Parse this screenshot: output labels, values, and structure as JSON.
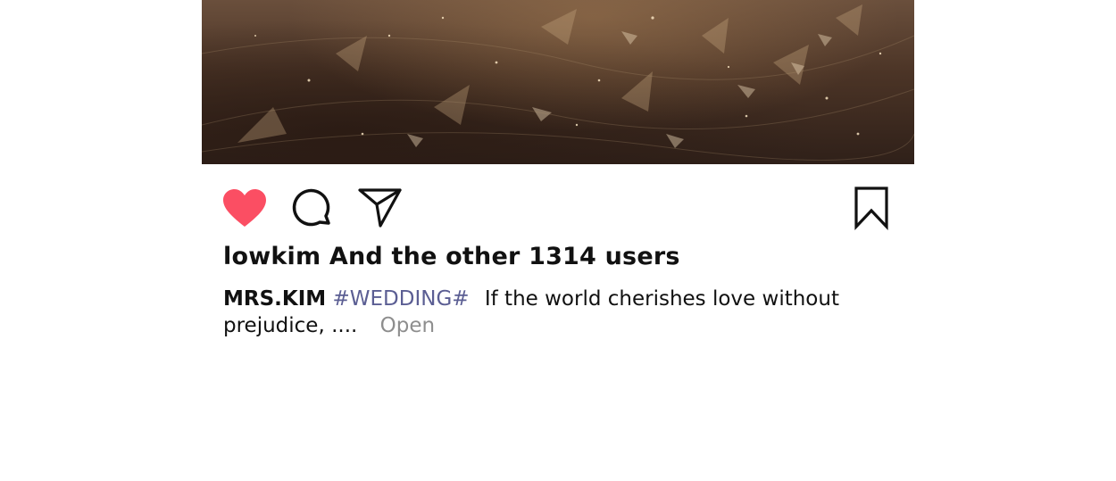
{
  "post": {
    "likes_text": "lowkim And the other 1314 users",
    "caption": {
      "username": "MRS.KIM",
      "hashtag": "#WEDDING#",
      "text": "If the world cherishes love without prejudice, ....",
      "more_label": "Open"
    }
  },
  "icons": {
    "like": "heart-icon",
    "comment": "comment-bubble-icon",
    "share": "send-icon",
    "save": "bookmark-icon"
  },
  "colors": {
    "like_active": "#fb4e63",
    "hashtag": "#5b5e93",
    "more_link": "#8e8e8e"
  }
}
